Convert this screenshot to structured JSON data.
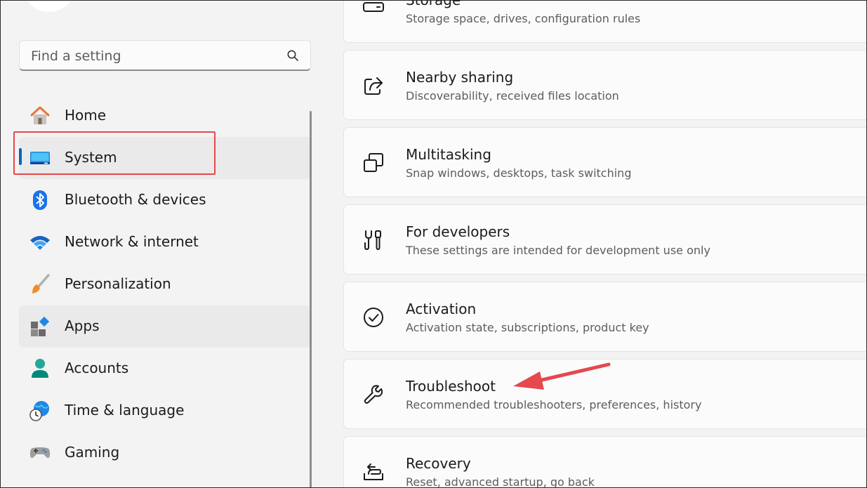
{
  "search": {
    "placeholder": "Find a setting"
  },
  "nav": {
    "items": [
      {
        "label": "Home",
        "icon": "home-icon"
      },
      {
        "label": "System",
        "icon": "system-monitor-icon",
        "selected": true
      },
      {
        "label": "Bluetooth & devices",
        "icon": "bluetooth-icon"
      },
      {
        "label": "Network & internet",
        "icon": "wifi-icon"
      },
      {
        "label": "Personalization",
        "icon": "paintbrush-icon"
      },
      {
        "label": "Apps",
        "icon": "apps-icon"
      },
      {
        "label": "Accounts",
        "icon": "account-icon"
      },
      {
        "label": "Time & language",
        "icon": "globe-clock-icon"
      },
      {
        "label": "Gaming",
        "icon": "gamepad-icon"
      }
    ]
  },
  "cards": [
    {
      "title": "Storage",
      "subtitle": "Storage space, drives, configuration rules",
      "icon": "storage-drive-icon"
    },
    {
      "title": "Nearby sharing",
      "subtitle": "Discoverability, received files location",
      "icon": "share-icon"
    },
    {
      "title": "Multitasking",
      "subtitle": "Snap windows, desktops, task switching",
      "icon": "multitasking-icon"
    },
    {
      "title": "For developers",
      "subtitle": "These settings are intended for development use only",
      "icon": "developer-tools-icon"
    },
    {
      "title": "Activation",
      "subtitle": "Activation state, subscriptions, product key",
      "icon": "checkmark-circle-icon"
    },
    {
      "title": "Troubleshoot",
      "subtitle": "Recommended troubleshooters, preferences, history",
      "icon": "wrench-icon"
    },
    {
      "title": "Recovery",
      "subtitle": "Reset, advanced startup, go back",
      "icon": "recovery-icon"
    }
  ],
  "colors": {
    "accent": "#0067c0",
    "annotation": "#e5484d"
  }
}
